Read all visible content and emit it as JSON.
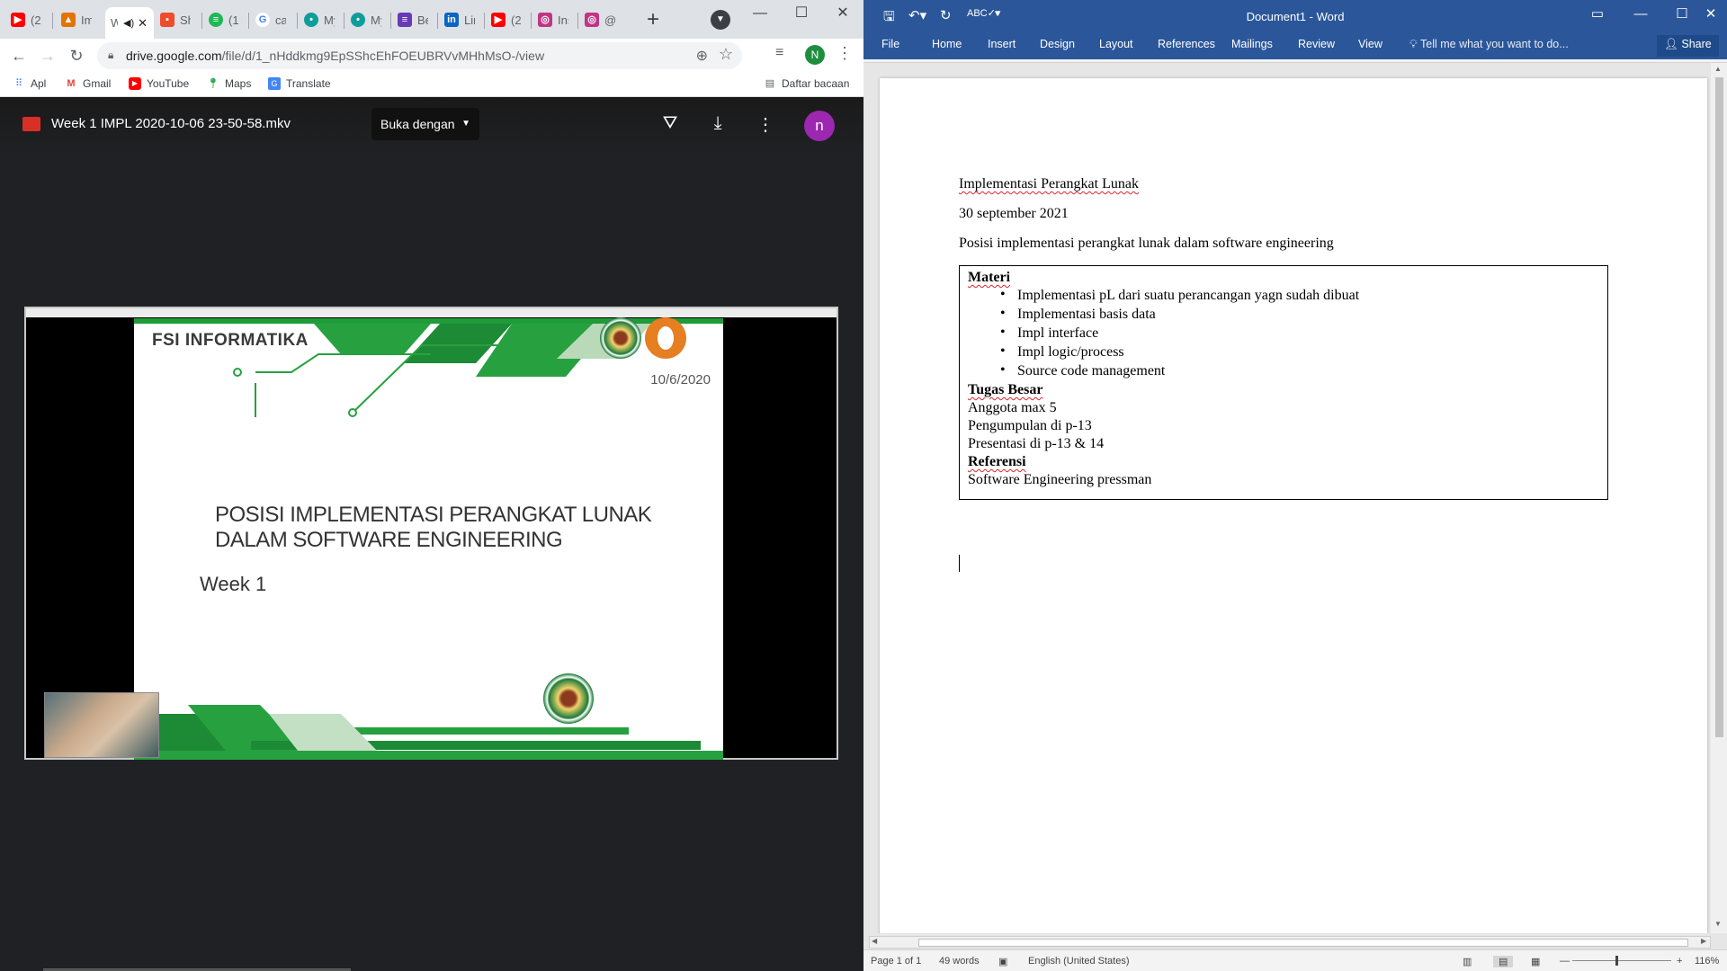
{
  "chrome": {
    "tabs": [
      {
        "title": "(2…",
        "fav": "youtube",
        "color": "#ff0000"
      },
      {
        "title": "Im",
        "fav": "image",
        "color": "#e37400"
      },
      {
        "title": "W",
        "fav": "audio",
        "color": "#202124"
      },
      {
        "title": "Sh",
        "fav": "slides",
        "color": "#ee4c2c"
      },
      {
        "title": "(1…",
        "fav": "green",
        "color": "#1db954"
      },
      {
        "title": "ca",
        "fav": "google",
        "color": "#4285f4"
      },
      {
        "title": "My",
        "fav": "teal",
        "color": "#0f9d9a"
      },
      {
        "title": "My",
        "fav": "teal",
        "color": "#0f9d9a"
      },
      {
        "title": "Be",
        "fav": "purple",
        "color": "#673ab7"
      },
      {
        "title": "Lin",
        "fav": "linkedin",
        "color": "#0a66c2"
      },
      {
        "title": "(2…",
        "fav": "youtube",
        "color": "#ff0000"
      },
      {
        "title": "Ins",
        "fav": "instagram",
        "color": "#c13584"
      },
      {
        "title": "@",
        "fav": "instagram",
        "color": "#c13584"
      }
    ],
    "url_host": "drive.google.com",
    "url_path": "/file/d/1_nHddkmg9EpSShcEhFOEUBRVvMHhMsO-/view",
    "profile_initial": "N",
    "bookmarks": [
      {
        "label": "Apl",
        "icon": "apps-grid-icon"
      },
      {
        "label": "Gmail",
        "icon": "gmail-icon"
      },
      {
        "label": "YouTube",
        "icon": "youtube-icon"
      },
      {
        "label": "Maps",
        "icon": "maps-icon"
      },
      {
        "label": "Translate",
        "icon": "translate-icon"
      }
    ],
    "reading_list": "Daftar bacaan"
  },
  "viewer": {
    "file_name": "Week 1 IMPL 2020-10-06 23-50-58.mkv",
    "open_with": "Buka dengan",
    "avatar_initial": "n",
    "slide": {
      "header": "FSI INFORMATIKA",
      "date": "10/6/2020",
      "title_line1": "POSISI IMPLEMENTASI PERANGKAT LUNAK",
      "title_line2": "DALAM SOFTWARE ENGINEERING",
      "week": "Week 1"
    }
  },
  "word": {
    "title": "Document1 - Word",
    "tabs": [
      "File",
      "Home",
      "Insert",
      "Design",
      "Layout",
      "References",
      "Mailings",
      "Review",
      "View"
    ],
    "tell_me": "Tell me what you want to do...",
    "share": "Share",
    "doc": {
      "line1": "Implementasi Perangkat Lunak",
      "line2": "30 september 2021",
      "line3": "Posisi implementasi perangkat lunak dalam software engineering",
      "materi_heading": "Materi",
      "materi_items": [
        "Implementasi pL dari suatu perancangan yagn sudah dibuat",
        "Implementasi basis data",
        "Impl interface",
        "Impl logic/process",
        "Source code management"
      ],
      "tugas_heading": "Tugas Besar",
      "tugas_lines": [
        "Anggota max 5",
        "Pengumpulan di p-13",
        "Presentasi di p-13 & 14"
      ],
      "ref_heading": "Referensi",
      "ref_line": "Software Engineering pressman"
    },
    "status": {
      "page": "Page 1 of 1",
      "words": "49 words",
      "language": "English (United States)",
      "zoom": "116%"
    }
  }
}
